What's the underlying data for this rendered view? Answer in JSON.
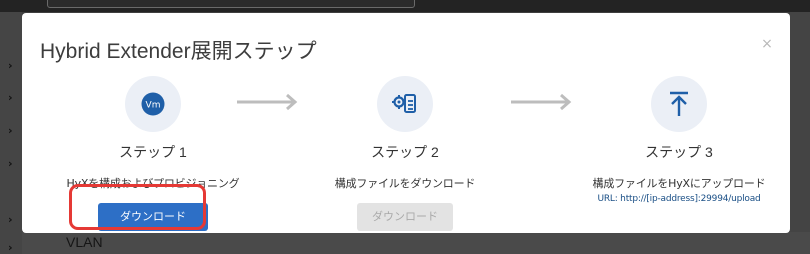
{
  "background": {
    "sidebar_item_label": "VLAN"
  },
  "modal": {
    "title": "Hybrid Extender展開ステップ",
    "close_glyph": "×"
  },
  "steps": [
    {
      "icon": "vm-icon",
      "icon_text": "Vm",
      "label": "ステップ 1",
      "description": "HyXを構成およびプロビジョニング",
      "button": "ダウンロード",
      "button_state": "enabled"
    },
    {
      "icon": "config-file-gear-icon",
      "label": "ステップ 2",
      "description": "構成ファイルをダウンロード",
      "button": "ダウンロード",
      "button_state": "disabled"
    },
    {
      "icon": "upload-icon",
      "label": "ステップ 3",
      "description": "構成ファイルをHyXにアップロード",
      "url": "URL: http://[ip-address]:29994/upload"
    }
  ],
  "colors": {
    "accent": "#2d6fc6",
    "icon_circle": "#ebeff6",
    "icon_blue": "#1f5fa8",
    "highlight": "#e53935"
  }
}
